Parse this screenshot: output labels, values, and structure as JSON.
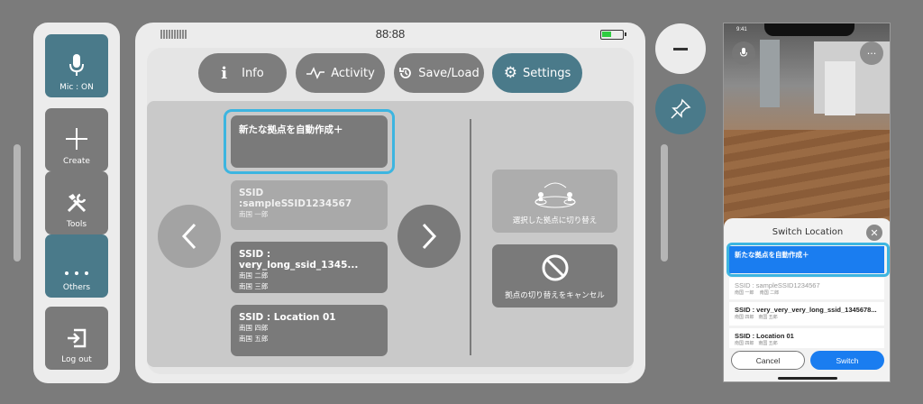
{
  "sidebar": {
    "items": [
      {
        "label": "Mic : ON",
        "icon": "mic-icon",
        "active": true
      },
      {
        "label": "Create",
        "icon": "plus-icon"
      },
      {
        "label": "Tools",
        "icon": "tools-icon"
      },
      {
        "label": "Others",
        "icon": "more-icon",
        "active": true
      },
      {
        "label": "Log out",
        "icon": "logout-icon"
      }
    ]
  },
  "status_bar": {
    "time": "88:88"
  },
  "tabs": [
    {
      "label": "Info",
      "icon": "info-icon"
    },
    {
      "label": "Activity",
      "icon": "activity-icon"
    },
    {
      "label": "Save/Load",
      "icon": "history-icon"
    },
    {
      "label": "Settings",
      "icon": "gear-icon",
      "active": true
    }
  ],
  "locations": [
    {
      "title": "新たな拠点を自動作成＋",
      "lines": [],
      "selected": true
    },
    {
      "title": "SSID :sampleSSID1234567",
      "lines": [
        "南国 一郎"
      ],
      "dimmed": true
    },
    {
      "title": "SSID : very_long_ssid_1345...",
      "lines": [
        "南国 二郎",
        "南国 三郎"
      ]
    },
    {
      "title": "SSID : Location 01",
      "lines": [
        "南国 四郎",
        "南国 五郎"
      ]
    }
  ],
  "actions": {
    "switch_label": "選択した拠点に切り替え",
    "cancel_label": "拠点の切り替えをキャンセル"
  },
  "phone": {
    "status_time": "9:41",
    "sheet_title": "Switch Location",
    "items": [
      {
        "title": "新たな拠点を自動作成＋",
        "sub": "",
        "selected": true
      },
      {
        "title": "SSID : sampleSSID1234567",
        "sub": "南国 一郎 　南国 二郎",
        "dimmed": true
      },
      {
        "title": "SSID : very_very_very_long_ssid_1345678...",
        "sub": "南国 四郎　南国 五郎"
      },
      {
        "title": "SSID : Location 01",
        "sub": "南国 四郎　南国 五郎"
      }
    ],
    "cancel_label": "Cancel",
    "switch_label": "Switch"
  },
  "colors": {
    "accent": "#4a7a8a",
    "highlight": "#3db5e0",
    "phone_primary": "#1a7df0"
  }
}
